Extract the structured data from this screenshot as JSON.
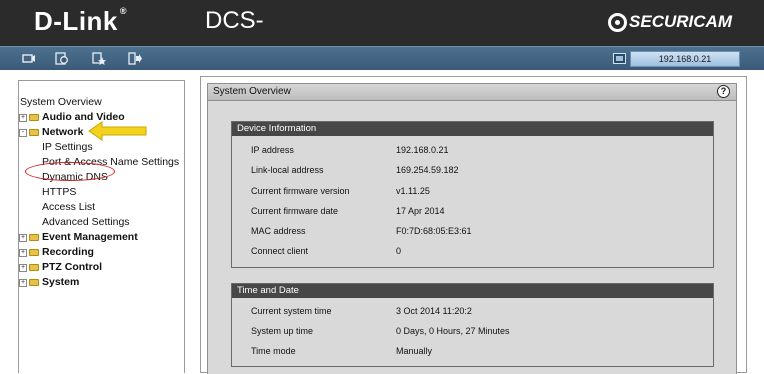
{
  "header": {
    "brand": "D-Link",
    "model": "DCS-",
    "product_line": "SECURICAM"
  },
  "toolbar": {
    "icons": [
      "camera-icon",
      "setup-icon",
      "maintenance-icon",
      "status-icon"
    ],
    "ip_address": "192.168.0.21"
  },
  "sidebar": {
    "root": "System Overview",
    "items": [
      {
        "label": "Audio and Video",
        "expander": "+"
      },
      {
        "label": "Network",
        "expander": "-"
      },
      {
        "label": "Event Management",
        "expander": "+"
      },
      {
        "label": "Recording",
        "expander": "+"
      },
      {
        "label": "PTZ Control",
        "expander": "+"
      },
      {
        "label": "System",
        "expander": "+"
      }
    ],
    "network_children": [
      "IP Settings",
      "Port & Access Name Settings",
      "Dynamic DNS",
      "HTTPS",
      "Access List",
      "Advanced Settings"
    ]
  },
  "main": {
    "title": "System Overview",
    "help_label": "?",
    "device_info": {
      "title": "Device Information",
      "rows": [
        {
          "key": "IP address",
          "value": "192.168.0.21"
        },
        {
          "key": "Link-local address",
          "value": "169.254.59.182"
        },
        {
          "key": "Current firmware version",
          "value": "v1.11.25"
        },
        {
          "key": "Current firmware date",
          "value": "17 Apr 2014"
        },
        {
          "key": "MAC address",
          "value": "F0:7D:68:05:E3:61"
        },
        {
          "key": "Connect client",
          "value": "0"
        }
      ]
    },
    "time_date": {
      "title": "Time and Date",
      "rows": [
        {
          "key": "Current system time",
          "value": "3 Oct 2014 11:20:2"
        },
        {
          "key": "System up time",
          "value": "0 Days, 0 Hours, 27 Minutes"
        },
        {
          "key": "Time mode",
          "value": "Manually"
        }
      ]
    }
  },
  "annotation_colors": {
    "arrow": "#f2d21b",
    "circle": "#cc2020"
  }
}
